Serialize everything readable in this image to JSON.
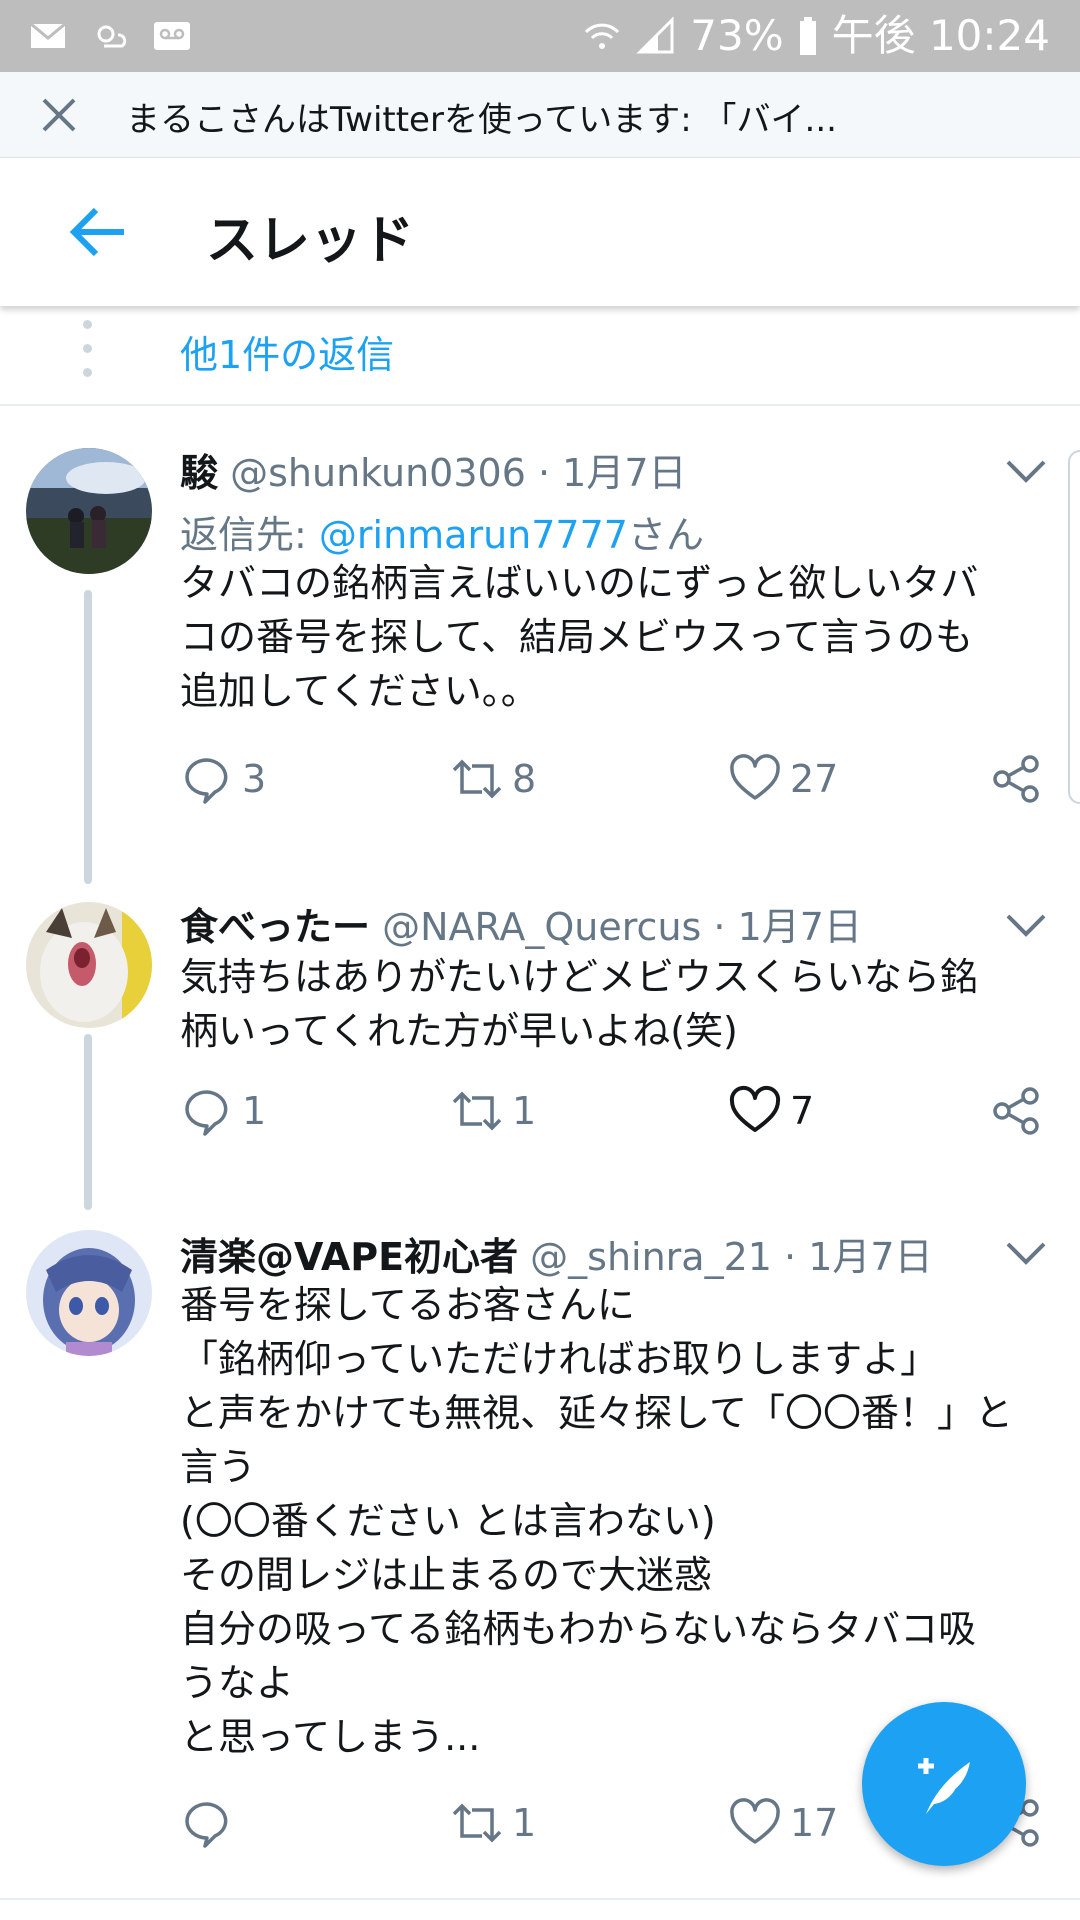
{
  "status_bar": {
    "battery": "73%",
    "time": "午後 10:24"
  },
  "chrome": {
    "title": "まるこさんはTwitterを使っています: 「バイ..."
  },
  "header": {
    "title": "スレッド"
  },
  "more_replies": {
    "label": "他1件の返信"
  },
  "tweets": [
    {
      "name": "駿",
      "handle": "@shunkun0306",
      "sep": "·",
      "date": "1月7日",
      "reply_prefix": "返信先: ",
      "reply_mention": "@rinmarun7777",
      "reply_suffix": "さん",
      "text": "タバコの銘柄言えばいいのにずっと欲しいタバ\nコの番号を探して、結局メビウスって言うのも\n追加してください。。",
      "replies": "3",
      "retweets": "8",
      "likes": "27"
    },
    {
      "name": "食べったー",
      "handle": "@NARA_Quercus",
      "sep": "·",
      "date": "1月7日",
      "text": "気持ちはありがたいけどメビウスくらいなら銘\n柄いってくれた方が早いよね(笑)",
      "replies": "1",
      "retweets": "1",
      "likes": "7"
    },
    {
      "name": "清楽@VAPE初心者",
      "handle": "@_shinra_21",
      "sep": "·",
      "date": "1月7日",
      "text": "番号を探してるお客さんに\n「銘柄仰っていただければお取りしますよ」\nと声をかけても無視、延々探して「〇〇番！」と\n言う\n(〇〇番ください とは言わない)\nその間レジは止まるので大迷惑\n自分の吸ってる銘柄もわからないならタバコ吸\nうなよ\nと思ってしまう...",
      "replies": "",
      "retweets": "1",
      "likes": "17"
    }
  ],
  "colors": {
    "accent": "#1da1f2",
    "muted": "#657786",
    "text": "#14171a",
    "status_bar": "#bdbdbd"
  },
  "icons": [
    "mail-icon",
    "weather-icon",
    "voicemail-icon",
    "wifi-icon",
    "signal-icon",
    "battery-icon",
    "close-icon",
    "back-arrow-icon",
    "chevron-down-icon",
    "reply-icon",
    "retweet-icon",
    "like-icon",
    "share-icon",
    "compose-icon"
  ]
}
